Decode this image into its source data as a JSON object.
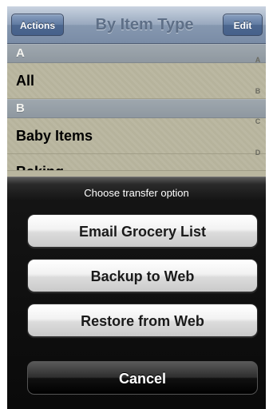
{
  "navbar": {
    "title": "By Item Type",
    "left_button": "Actions",
    "right_button": "Edit"
  },
  "list": {
    "sections": [
      {
        "header": "A",
        "rows": [
          "All"
        ]
      },
      {
        "header": "B",
        "rows": [
          "Baby Items",
          "Baking"
        ]
      }
    ]
  },
  "index_letters": [
    "A",
    "B",
    "C",
    "D"
  ],
  "action_sheet": {
    "title": "Choose transfer option",
    "buttons": [
      "Email Grocery List",
      "Backup to Web",
      "Restore from Web"
    ],
    "cancel": "Cancel"
  },
  "colors": {
    "sheet_background": "#0a0a0a",
    "navbar_tint": "#8698b0"
  }
}
